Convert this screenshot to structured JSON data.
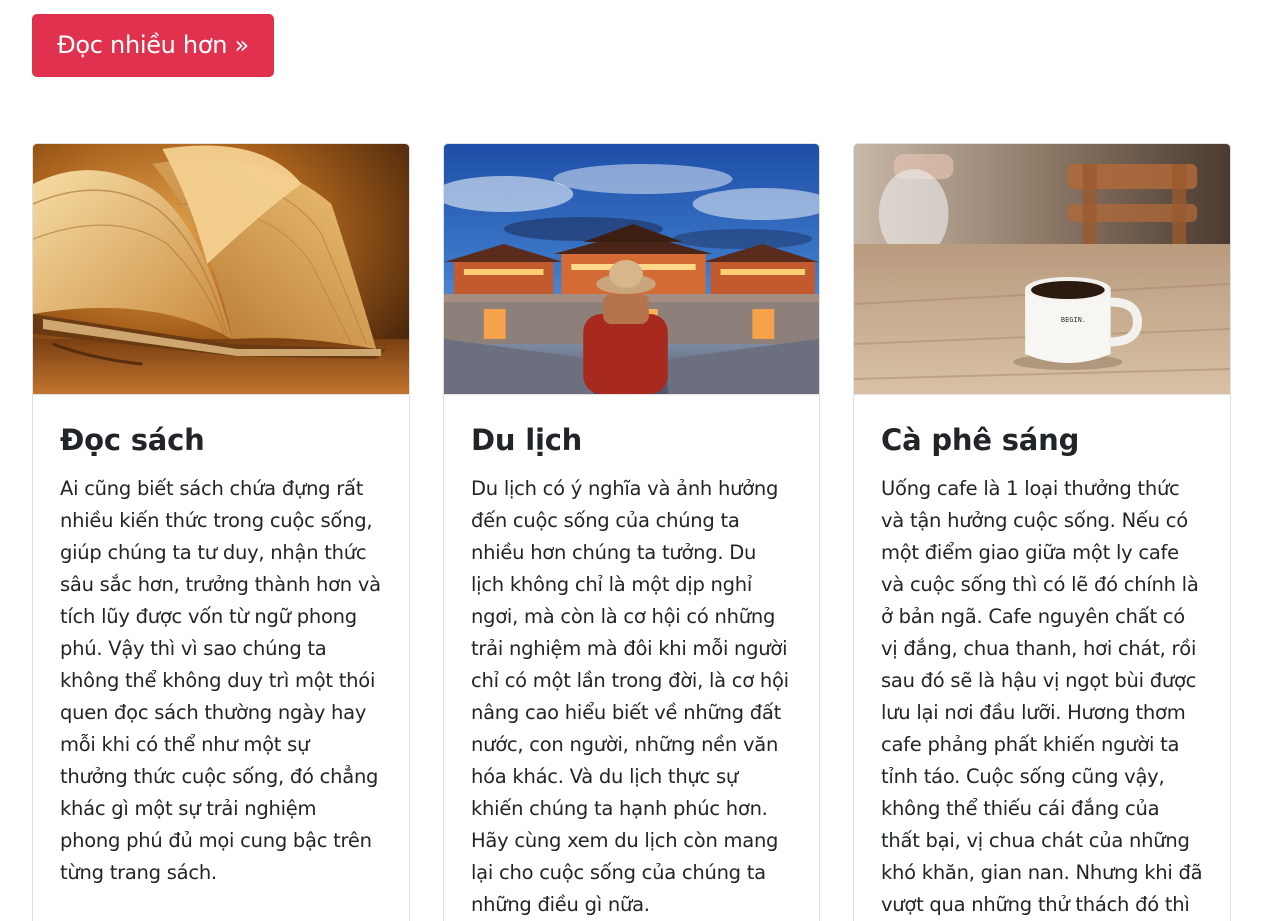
{
  "read_more_button": {
    "label": "Đọc nhiều hơn »",
    "color": "#e0314f"
  },
  "cards": [
    {
      "image": "open-book-photo",
      "title": "Đọc sách",
      "text": "Ai cũng biết sách chứa đựng rất nhiều kiến thức trong cuộc sống, giúp chúng ta tư duy, nhận thức sâu sắc hơn, trưởng thành hơn và tích lũy được vốn từ ngữ phong phú. Vậy thì vì sao chúng ta không thể không duy trì một thói quen đọc sách thường ngày hay mỗi khi có thể như một sự thưởng thức cuộc sống, đó chẳng khác gì một sự trải nghiệm phong phú đủ mọi cung bậc trên từng trang sách."
    },
    {
      "image": "traveler-at-imperial-gate-photo",
      "title": "Du lịch",
      "text": "Du lịch có ý nghĩa và ảnh hưởng đến cuộc sống của chúng ta nhiều hơn chúng ta tưởng. Du lịch không chỉ là một dịp nghỉ ngơi, mà còn là cơ hội có những trải nghiệm mà đôi khi mỗi người chỉ có một lần trong đời, là cơ hội nâng cao hiểu biết về những đất nước, con người, những nền văn hóa khác. Và du lịch thực sự khiến chúng ta hạnh phúc hơn. Hãy cùng xem du lịch còn mang lại cho cuộc sống của chúng ta những điều gì nữa."
    },
    {
      "image": "coffee-mug-on-table-photo",
      "title": "Cà phê sáng",
      "text": "Uống cafe là 1 loại thưởng thức và tận hưởng cuộc sống. Nếu có một điểm giao giữa một ly cafe và cuộc sống thì có lẽ đó chính là ở bản ngã. Cafe nguyên chất có vị đắng, chua thanh, hơi chát, rồi sau đó sẽ là hậu vị ngọt bùi được lưu lại nơi đầu lưỡi. Hương thơm cafe phảng phất khiến người ta tỉnh táo. Cuộc sống cũng vậy, không thể thiếu cái đắng của thất bại, vị chua chát của những khó khăn, gian nan. Nhưng khi đã vượt qua những thử thách đó thì"
    }
  ],
  "mug_text": "BEGIN."
}
